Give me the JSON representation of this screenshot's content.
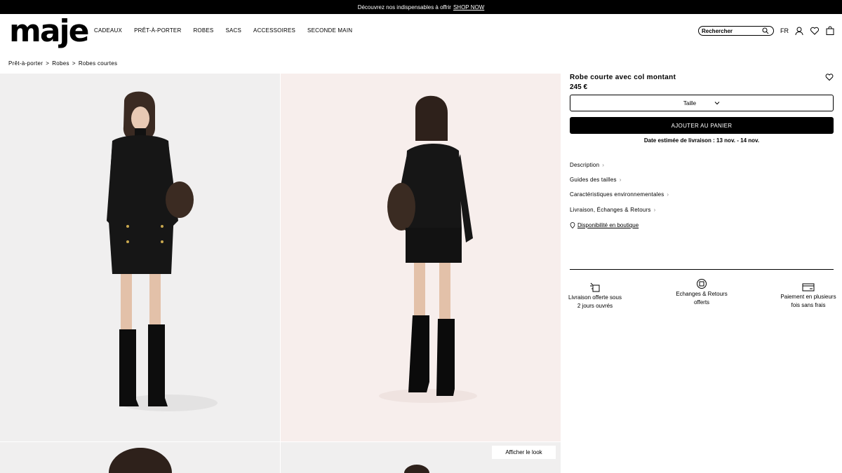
{
  "topbar": {
    "text": "Découvrez nos indispensables à offrir",
    "link": "SHOP NOW"
  },
  "header": {
    "logo": "maje",
    "nav": [
      "CADEAUX",
      "PRÊT-À-PORTER",
      "ROBES",
      "SACS",
      "ACCESSOIRES",
      "SECONDE MAIN"
    ],
    "search_placeholder": "Rechercher",
    "lang": "FR"
  },
  "breadcrumb": [
    "Prêt-à-porter",
    ">",
    "Robes",
    ">",
    "Robes courtes"
  ],
  "gallery": {
    "look_button": "Afficher le look"
  },
  "product": {
    "title": "Robe courte avec col montant",
    "price": "245 €",
    "size_label": "Taille",
    "add_to_cart": "AJOUTER AU PANIER",
    "delivery": "Date estimée de livraison : 13 nov. - 14 nov.",
    "accordion": [
      "Description",
      "Guides des tailles",
      "Caractéristiques environnementales",
      "Livraison, Échanges & Retours"
    ],
    "availability": "Disponibilité en boutique"
  },
  "features": [
    {
      "icon": "delivery-box-icon",
      "label": "Livraison offerte sous 2 jours ouvrés"
    },
    {
      "icon": "returns-icon",
      "label": "Echanges & Retours offerts"
    },
    {
      "icon": "credit-card-icon",
      "label": "Paiement en plusieurs fois sans frais"
    }
  ]
}
